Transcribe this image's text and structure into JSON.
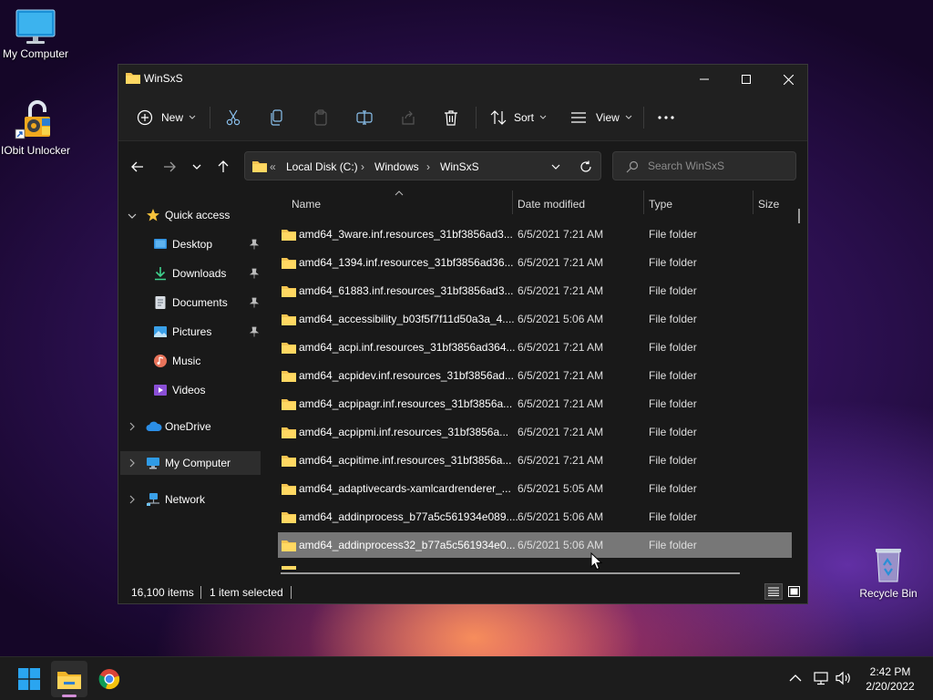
{
  "desktop": {
    "icons": [
      {
        "label": "My Computer"
      },
      {
        "label": "IObit Unlocker"
      },
      {
        "label": "Recycle Bin"
      }
    ]
  },
  "window": {
    "title": "WinSxS",
    "toolbar": {
      "new_label": "New",
      "sort_label": "Sort",
      "view_label": "View"
    },
    "address": {
      "overflow": "«",
      "crumbs": [
        "Local Disk (C:)",
        "Windows",
        "WinSxS"
      ]
    },
    "search": {
      "placeholder": "Search WinSxS"
    },
    "nav": {
      "quick_access": "Quick access",
      "items": [
        "Desktop",
        "Downloads",
        "Documents",
        "Pictures",
        "Music",
        "Videos"
      ],
      "onedrive": "OneDrive",
      "my_computer": "My Computer",
      "network": "Network"
    },
    "columns": {
      "name": "Name",
      "date": "Date modified",
      "type": "Type",
      "size": "Size"
    },
    "files": [
      {
        "name": "amd64_3ware.inf.resources_31bf3856ad3...",
        "date": "6/5/2021 7:21 AM",
        "type": "File folder"
      },
      {
        "name": "amd64_1394.inf.resources_31bf3856ad36...",
        "date": "6/5/2021 7:21 AM",
        "type": "File folder"
      },
      {
        "name": "amd64_61883.inf.resources_31bf3856ad3...",
        "date": "6/5/2021 7:21 AM",
        "type": "File folder"
      },
      {
        "name": "amd64_accessibility_b03f5f7f11d50a3a_4....",
        "date": "6/5/2021 5:06 AM",
        "type": "File folder"
      },
      {
        "name": "amd64_acpi.inf.resources_31bf3856ad364...",
        "date": "6/5/2021 7:21 AM",
        "type": "File folder"
      },
      {
        "name": "amd64_acpidev.inf.resources_31bf3856ad...",
        "date": "6/5/2021 7:21 AM",
        "type": "File folder"
      },
      {
        "name": "amd64_acpipagr.inf.resources_31bf3856a...",
        "date": "6/5/2021 7:21 AM",
        "type": "File folder"
      },
      {
        "name": "amd64_acpipmi.inf.resources_31bf3856a...",
        "date": "6/5/2021 7:21 AM",
        "type": "File folder"
      },
      {
        "name": "amd64_acpitime.inf.resources_31bf3856a...",
        "date": "6/5/2021 7:21 AM",
        "type": "File folder"
      },
      {
        "name": "amd64_adaptivecards-xamlcardrenderer_...",
        "date": "6/5/2021 5:05 AM",
        "type": "File folder"
      },
      {
        "name": "amd64_addinprocess_b77a5c561934e089....",
        "date": "6/5/2021 5:06 AM",
        "type": "File folder"
      },
      {
        "name": "amd64_addinprocess32_b77a5c561934e0...",
        "date": "6/5/2021 5:06 AM",
        "type": "File folder"
      }
    ],
    "status": {
      "count": "16,100 items",
      "selected": "1 item selected"
    }
  },
  "taskbar": {
    "clock_time": "2:42 PM",
    "clock_date": "2/20/2022"
  }
}
